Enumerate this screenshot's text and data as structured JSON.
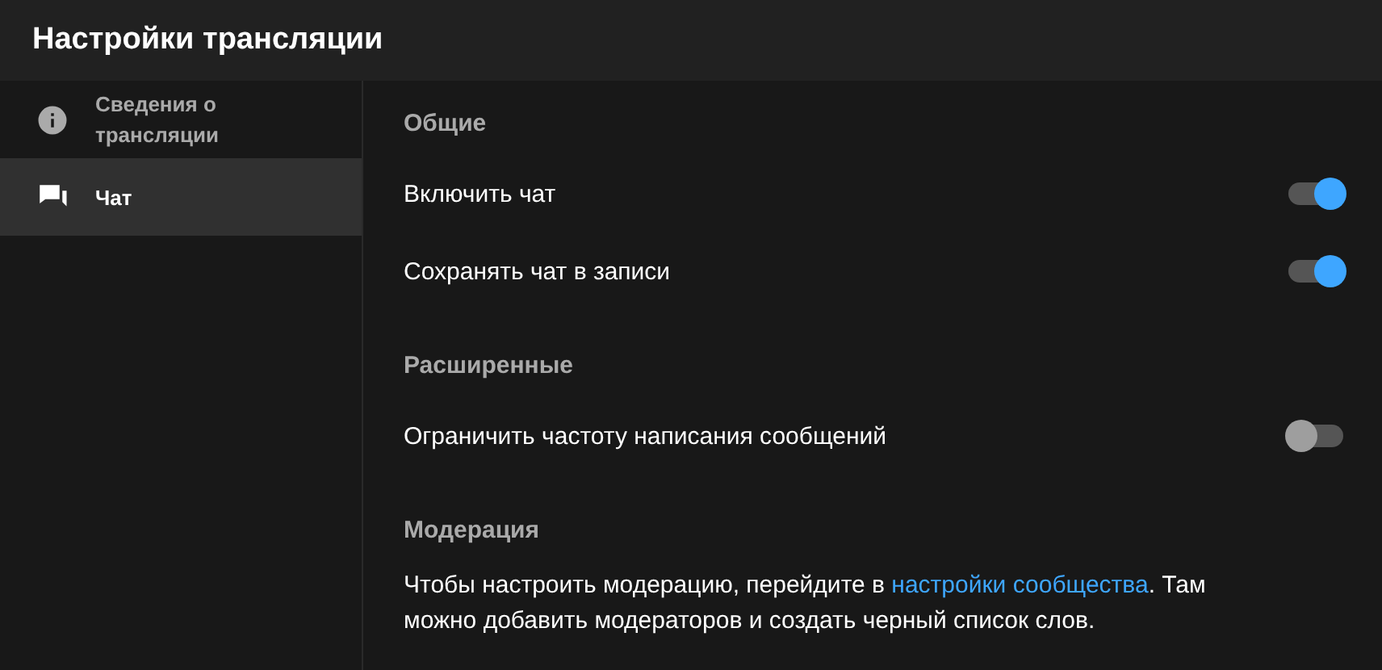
{
  "header": {
    "title": "Настройки трансляции"
  },
  "sidebar": {
    "items": [
      {
        "label": "Сведения о трансляции",
        "kind": "info",
        "selected": false
      },
      {
        "label": "Чат",
        "kind": "chat",
        "selected": true
      }
    ]
  },
  "sections": [
    {
      "title": "Общие",
      "rows": [
        {
          "kind": "toggle",
          "label": "Включить чат",
          "on": true
        },
        {
          "kind": "toggle",
          "label": "Сохранять чат в записи",
          "on": true
        }
      ]
    },
    {
      "title": "Расширенные",
      "rows": [
        {
          "kind": "toggle",
          "label": "Ограничить частоту написания сообщений",
          "on": false
        }
      ]
    },
    {
      "title": "Модерация",
      "rows": [
        {
          "kind": "text",
          "before": "Чтобы настроить модерацию, перейдите в ",
          "link": "настройки сообщества",
          "after": ". Там можно добавить модераторов и создать черный список слов."
        }
      ]
    }
  ]
}
